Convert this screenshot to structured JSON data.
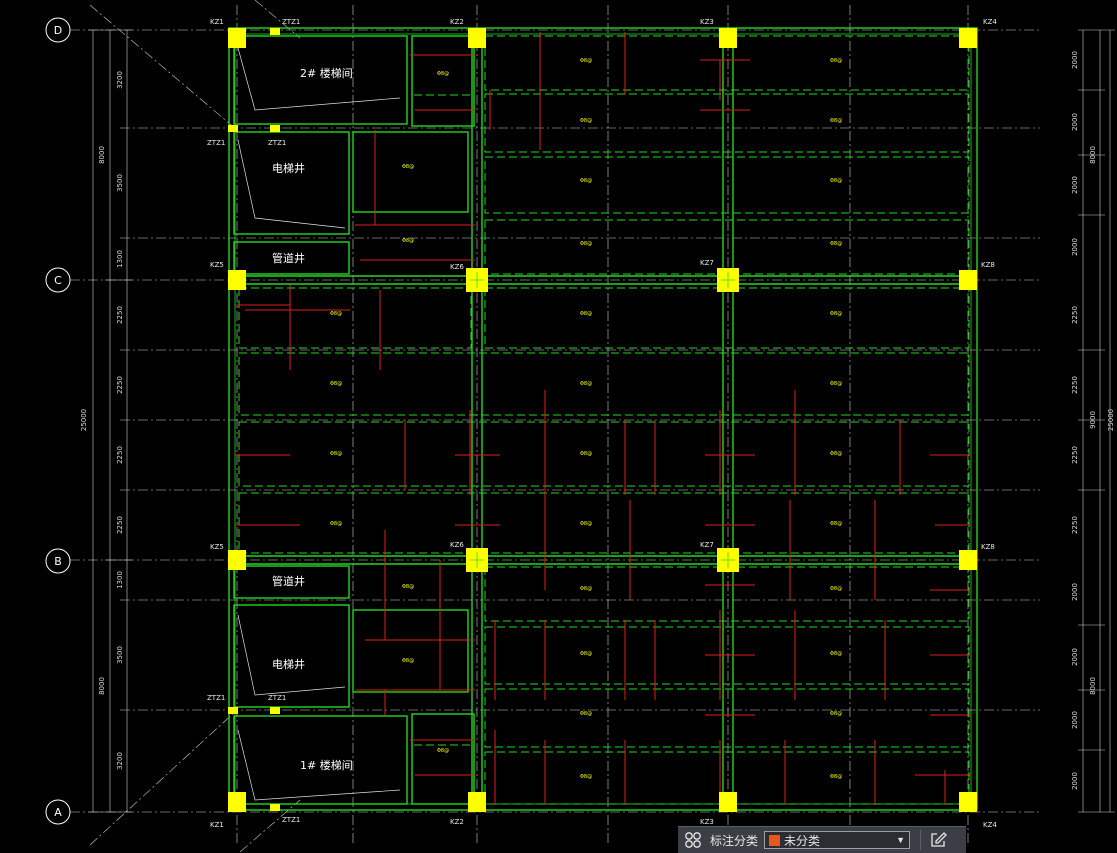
{
  "axes": {
    "rows": [
      "D",
      "C",
      "B",
      "A"
    ]
  },
  "columns": {
    "top": [
      "KZ1",
      "ZTZ1",
      "KZ2",
      "KZ3",
      "KZ4"
    ],
    "c_row": [
      "KZ5",
      "KZ6",
      "KZ7",
      "KZ8"
    ],
    "b_row": [
      "KZ5",
      "KZ6",
      "KZ7",
      "KZ8"
    ],
    "bottom": [
      "KZ1",
      "ZTZ1",
      "KZ2",
      "KZ3",
      "KZ4"
    ],
    "ztz_mid_top": "ZTZ1",
    "ztz_mid_bottom": "ZTZ1",
    "ztz_side_top": "ZTZ1",
    "ztz_side_bottom": "ZTZ1"
  },
  "rooms": {
    "stair_2": "2# 楼梯间",
    "stair_1": "1# 楼梯间",
    "elevator_top": "电梯井",
    "elevator_bottom": "电梯井",
    "pipe_top": "管道井",
    "pipe_bottom": "管道井"
  },
  "dims_left": {
    "total": "25000",
    "section_top": "8000",
    "section_bottom": "8000",
    "segments": [
      "3200",
      "3500",
      "1300",
      "2250",
      "2250",
      "2250",
      "2250",
      "1300",
      "3500",
      "3200"
    ]
  },
  "dims_right": {
    "total": "25000",
    "section_top": "8000",
    "section_mid": "9000",
    "section_bottom": "8000",
    "segments": [
      "2000",
      "2000",
      "2000",
      "2000",
      "2250",
      "2250",
      "2250",
      "2250",
      "2000",
      "2000",
      "2000",
      "2000"
    ]
  },
  "rebar_label": "Φ8@",
  "toolbar": {
    "label": "标注分类",
    "selected": "未分类",
    "swatch_color": "#e8571d",
    "icon_left": "grid-four-circles-icon",
    "icon_right": "edit-note-icon"
  },
  "colors": {
    "background": "#000000",
    "beam": "#22d622",
    "rebar": "#d62020",
    "column": "#ffff00",
    "text": "#ffffff"
  }
}
